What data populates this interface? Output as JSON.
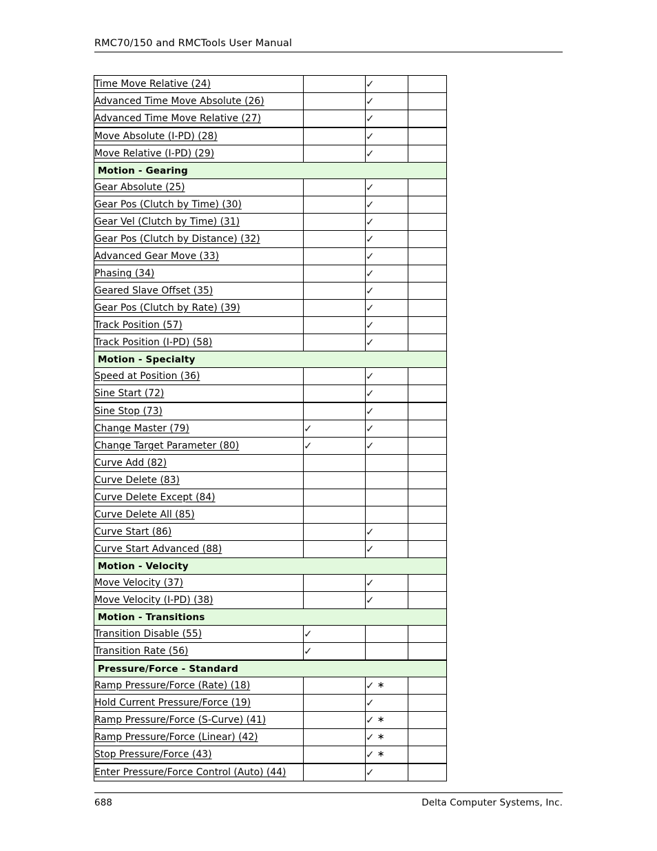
{
  "header": {
    "title": "RMC70/150 and RMCTools User Manual"
  },
  "footer": {
    "page_number": "688",
    "company": "Delta Computer Systems, Inc."
  },
  "table": {
    "check_glyph": "✓",
    "star_glyph": "∗",
    "section_bg": "#e2f9dd",
    "rows": [
      {
        "kind": "item",
        "label": "Time Move Relative (24)",
        "col1": "",
        "col2": "check",
        "col3": ""
      },
      {
        "kind": "item",
        "label": "Advanced Time Move Absolute (26)",
        "col1": "",
        "col2": "check",
        "col3": ""
      },
      {
        "kind": "item",
        "label": "Advanced Time Move Relative (27)",
        "col1": "",
        "col2": "check",
        "col3": ""
      },
      {
        "kind": "item",
        "label": "Move Absolute (I-PD) (28)",
        "col1": "",
        "col2": "check",
        "col3": "",
        "thick_top": true
      },
      {
        "kind": "item",
        "label": "Move Relative (I-PD) (29)",
        "col1": "",
        "col2": "check",
        "col3": ""
      },
      {
        "kind": "section",
        "label": "Motion - Gearing"
      },
      {
        "kind": "item",
        "label": "Gear Absolute (25)",
        "col1": "",
        "col2": "check",
        "col3": ""
      },
      {
        "kind": "item",
        "label": "Gear Pos (Clutch by Time) (30)",
        "col1": "",
        "col2": "check",
        "col3": ""
      },
      {
        "kind": "item",
        "label": "Gear Vel (Clutch by Time) (31)",
        "col1": "",
        "col2": "check",
        "col3": ""
      },
      {
        "kind": "item",
        "label": "Gear Pos (Clutch by Distance) (32)",
        "col1": "",
        "col2": "check",
        "col3": ""
      },
      {
        "kind": "item",
        "label": "Advanced Gear Move (33)",
        "col1": "",
        "col2": "check",
        "col3": ""
      },
      {
        "kind": "item",
        "label": "Phasing (34)",
        "col1": "",
        "col2": "check",
        "col3": ""
      },
      {
        "kind": "item",
        "label": "Geared Slave Offset (35)",
        "col1": "",
        "col2": "check",
        "col3": ""
      },
      {
        "kind": "item",
        "label": "Gear Pos (Clutch by Rate) (39)",
        "col1": "",
        "col2": "check",
        "col3": ""
      },
      {
        "kind": "item",
        "label": "Track Position (57)",
        "col1": "",
        "col2": "check",
        "col3": ""
      },
      {
        "kind": "item",
        "label": "Track Position (I-PD) (58)",
        "col1": "",
        "col2": "check",
        "col3": ""
      },
      {
        "kind": "section",
        "label": "Motion - Specialty"
      },
      {
        "kind": "item",
        "label": "Speed at Position (36)",
        "col1": "",
        "col2": "check",
        "col3": ""
      },
      {
        "kind": "item",
        "label": "Sine Start (72)",
        "col1": "",
        "col2": "check",
        "col3": ""
      },
      {
        "kind": "item",
        "label": "Sine Stop (73)",
        "col1": "",
        "col2": "check",
        "col3": "",
        "thick_top": true
      },
      {
        "kind": "item",
        "label": "Change Master (79)",
        "col1": "check",
        "col2": "check",
        "col3": ""
      },
      {
        "kind": "item",
        "label": "Change Target Parameter (80)",
        "col1": "check",
        "col2": "check",
        "col3": ""
      },
      {
        "kind": "item",
        "label": "Curve Add (82)",
        "col1": "",
        "col2": "",
        "col3": ""
      },
      {
        "kind": "item",
        "label": "Curve Delete (83)",
        "col1": "",
        "col2": "",
        "col3": ""
      },
      {
        "kind": "item",
        "label": "Curve Delete Except (84)",
        "col1": "",
        "col2": "",
        "col3": ""
      },
      {
        "kind": "item",
        "label": "Curve Delete All (85)",
        "col1": "",
        "col2": "",
        "col3": ""
      },
      {
        "kind": "item",
        "label": "Curve Start (86)",
        "col1": "",
        "col2": "check",
        "col3": ""
      },
      {
        "kind": "item",
        "label": "Curve Start Advanced (88)",
        "col1": "",
        "col2": "check",
        "col3": ""
      },
      {
        "kind": "section",
        "label": "Motion - Velocity"
      },
      {
        "kind": "item",
        "label": "Move Velocity (37)",
        "col1": "",
        "col2": "check",
        "col3": ""
      },
      {
        "kind": "item",
        "label": "Move Velocity (I-PD) (38)",
        "col1": "",
        "col2": "check",
        "col3": ""
      },
      {
        "kind": "section",
        "label": "Motion - Transitions"
      },
      {
        "kind": "item",
        "label": "Transition Disable (55)",
        "col1": "check",
        "col2": "",
        "col3": ""
      },
      {
        "kind": "item",
        "label": "Transition Rate (56)",
        "col1": "check",
        "col2": "",
        "col3": ""
      },
      {
        "kind": "section",
        "label": "Pressure/Force - Standard",
        "thick_top": true
      },
      {
        "kind": "item",
        "label": "Ramp Pressure/Force (Rate) (18)",
        "col1": "",
        "col2": "check-star",
        "col3": ""
      },
      {
        "kind": "item",
        "label": "Hold Current Pressure/Force (19)",
        "col1": "",
        "col2": "check",
        "col3": ""
      },
      {
        "kind": "item",
        "label": "Ramp Pressure/Force (S-Curve) (41)",
        "col1": "",
        "col2": "check-star",
        "col3": ""
      },
      {
        "kind": "item",
        "label": "Ramp Pressure/Force (Linear) (42)",
        "col1": "",
        "col2": "check-star",
        "col3": ""
      },
      {
        "kind": "item",
        "label": "Stop Pressure/Force (43)",
        "col1": "",
        "col2": "check-star",
        "col3": ""
      },
      {
        "kind": "item",
        "label": "Enter Pressure/Force Control (Auto) (44)",
        "col1": "",
        "col2": "check",
        "col3": "",
        "thick_top": true
      }
    ]
  }
}
